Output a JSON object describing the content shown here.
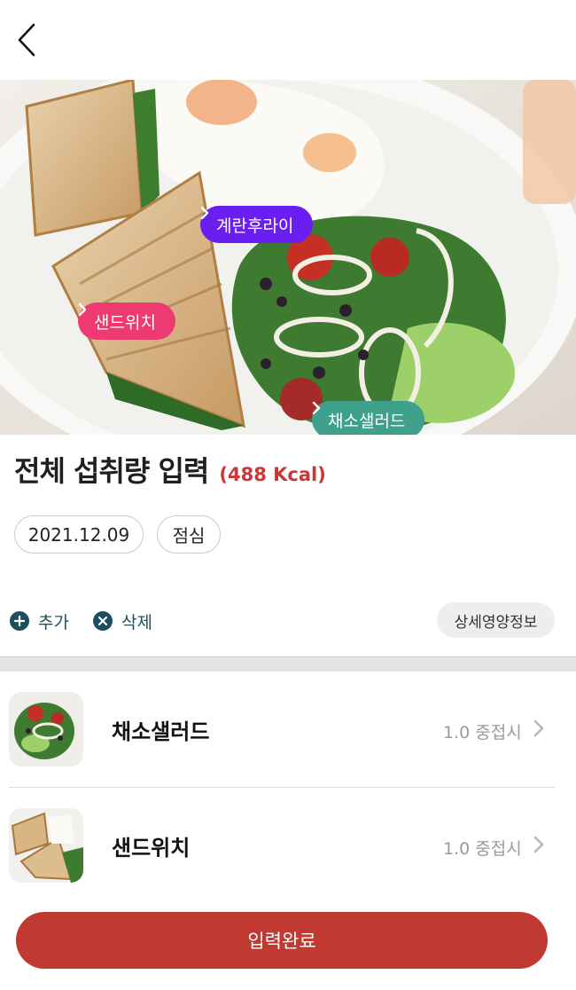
{
  "nav": {
    "back_icon": "chevron-left-icon"
  },
  "photo": {
    "tags": [
      {
        "label": "계란후라이",
        "color": "#6a1ff0"
      },
      {
        "label": "샌드위치",
        "color": "#ee3a72"
      },
      {
        "label": "채소샐러드",
        "color": "#3fa08c"
      }
    ]
  },
  "summary": {
    "title": "전체 섭취량 입력",
    "kcal": "(488 Kcal)",
    "kcal_color": "#c83838"
  },
  "meta": {
    "date": "2021.12.09",
    "meal": "점심"
  },
  "actions": {
    "add_label": "추가",
    "delete_label": "삭제",
    "detail_label": "상세영양정보"
  },
  "foods": [
    {
      "name": "채소샐러드",
      "amount": "1.0 중접시"
    },
    {
      "name": "샌드위치",
      "amount": "1.0 중접시"
    }
  ],
  "submit": {
    "label": "입력완료",
    "color": "#c13a32"
  }
}
